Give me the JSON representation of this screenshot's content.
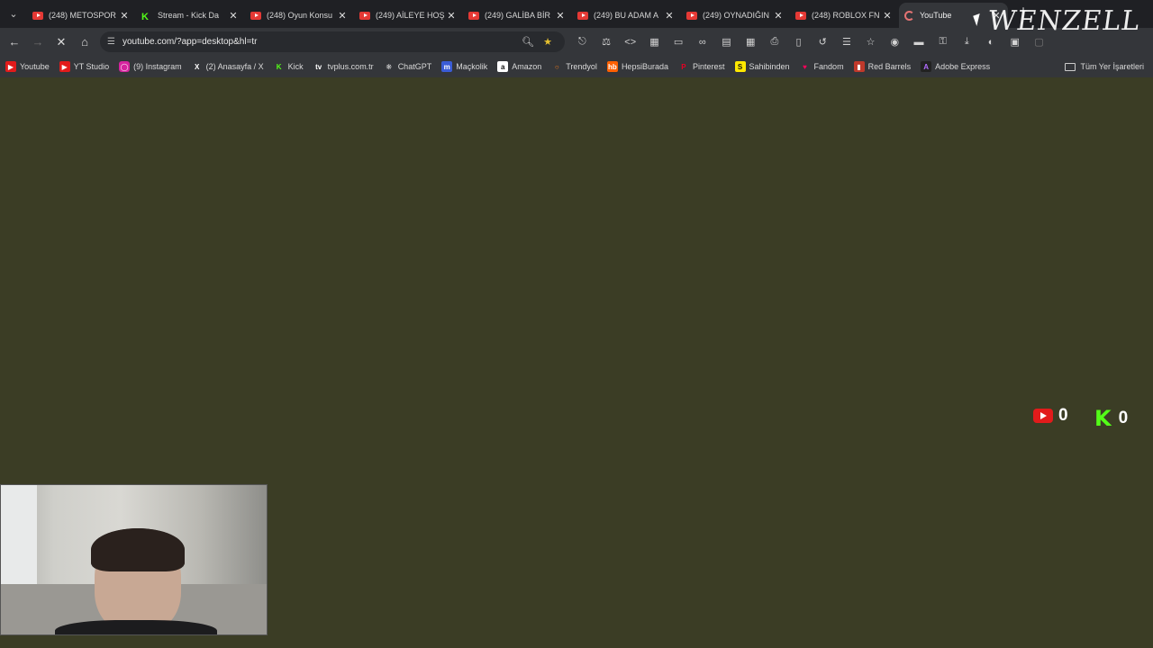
{
  "tabs": [
    {
      "title": "(248) METOSPOR",
      "icon": "youtube-icon"
    },
    {
      "title": "Stream - Kick Da",
      "icon": "kick-icon"
    },
    {
      "title": "(248) Oyun Konsu",
      "icon": "youtube-icon"
    },
    {
      "title": "(249) AİLEYE HOŞ",
      "icon": "youtube-icon"
    },
    {
      "title": "(249) GALİBA BİR",
      "icon": "youtube-icon"
    },
    {
      "title": "(249) BU ADAM A",
      "icon": "youtube-icon"
    },
    {
      "title": "(249) OYNADIĞIN",
      "icon": "youtube-icon"
    },
    {
      "title": "(248) ROBLOX FN",
      "icon": "youtube-icon"
    },
    {
      "title": "YouTube",
      "icon": "loading-icon",
      "active": true
    }
  ],
  "omnibox": {
    "url": "youtube.com/?app=desktop&hl=tr"
  },
  "bookmarks": [
    {
      "label": "Youtube",
      "icon": "youtube-icon",
      "color": "#e21b1b"
    },
    {
      "label": "YT Studio",
      "icon": "youtube-icon",
      "color": "#e21b1b"
    },
    {
      "label": "(9) Instagram",
      "icon": "instagram-icon",
      "color": "#d6249f"
    },
    {
      "label": "(2) Anasayfa / X",
      "icon": "x-icon",
      "color": "#ffffff"
    },
    {
      "label": "Kick",
      "icon": "kick-icon",
      "color": "#53fc18"
    },
    {
      "label": "tvplus.com.tr",
      "icon": "tvplus-icon",
      "color": "#ffffff"
    },
    {
      "label": "ChatGPT",
      "icon": "chatgpt-icon",
      "color": "#cccccc"
    },
    {
      "label": "Maçkolik",
      "icon": "mackolik-icon",
      "color": "#3a5cd6"
    },
    {
      "label": "Amazon",
      "icon": "amazon-icon",
      "color": "#ffffff"
    },
    {
      "label": "Trendyol",
      "icon": "trendyol-icon",
      "color": "#f27a1a"
    },
    {
      "label": "HepsiBurada",
      "icon": "hepsiburada-icon",
      "color": "#ff6000"
    },
    {
      "label": "Pinterest",
      "icon": "pinterest-icon",
      "color": "#e60023"
    },
    {
      "label": "Sahibinden",
      "icon": "sahibinden-icon",
      "color": "#ffe800"
    },
    {
      "label": "Fandom",
      "icon": "fandom-icon",
      "color": "#fa005a"
    },
    {
      "label": "Red Barrels",
      "icon": "redbarrels-icon",
      "color": "#c0392b"
    },
    {
      "label": "Adobe Express",
      "icon": "adobe-express-icon",
      "color": "#7b2fd0"
    }
  ],
  "all_bookmarks_label": "Tüm Yer İşaretleri",
  "overlay": {
    "youtube_count": "0",
    "kick_count": "0",
    "watermark": "WENZELL"
  },
  "colors": {
    "page_background": "#3b3d25",
    "tabstrip": "#1f2024",
    "toolbar": "#34363a"
  }
}
